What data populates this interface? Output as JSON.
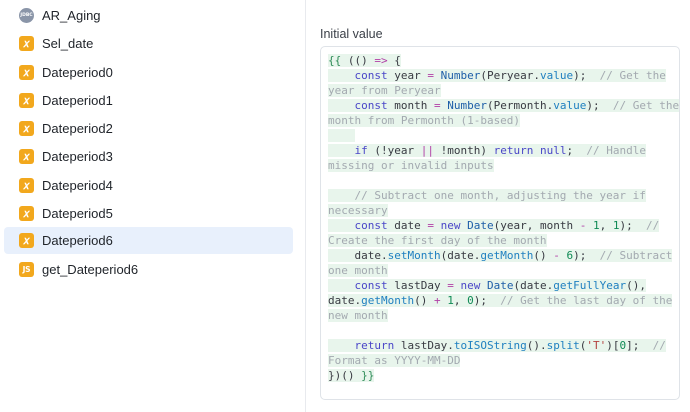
{
  "sidebar": {
    "items": [
      {
        "label": "AR_Aging",
        "icon": "database-icon",
        "icon_text": "JDBC",
        "selected": false
      },
      {
        "label": "Sel_date",
        "icon": "variable-icon",
        "icon_text": "𝑥",
        "selected": false
      },
      {
        "label": "Dateperiod0",
        "icon": "variable-icon",
        "icon_text": "𝑥",
        "selected": false
      },
      {
        "label": "Dateperiod1",
        "icon": "variable-icon",
        "icon_text": "𝑥",
        "selected": false
      },
      {
        "label": "Dateperiod2",
        "icon": "variable-icon",
        "icon_text": "𝑥",
        "selected": false
      },
      {
        "label": "Dateperiod3",
        "icon": "variable-icon",
        "icon_text": "𝑥",
        "selected": false
      },
      {
        "label": "Dateperiod4",
        "icon": "variable-icon",
        "icon_text": "𝑥",
        "selected": false
      },
      {
        "label": "Dateperiod5",
        "icon": "variable-icon",
        "icon_text": "𝑥",
        "selected": false
      },
      {
        "label": "Dateperiod6",
        "icon": "variable-icon",
        "icon_text": "𝑥",
        "selected": true
      },
      {
        "label": "get_Dateperiod6",
        "icon": "js-query-icon",
        "icon_text": "JS",
        "selected": false
      }
    ]
  },
  "panel": {
    "title": "Initial value",
    "code_lines": [
      [
        [
          "brace",
          "{{ "
        ],
        [
          "",
          "(() "
        ],
        [
          "op",
          "=>"
        ],
        [
          "",
          " {"
        ]
      ],
      [
        [
          "",
          "    "
        ],
        [
          "kw",
          "const"
        ],
        [
          "",
          " year "
        ],
        [
          "op",
          "="
        ],
        [
          "",
          " "
        ],
        [
          "fn",
          "Number"
        ],
        [
          "",
          "(Peryear."
        ],
        [
          "prop",
          "value"
        ],
        [
          "",
          ");  "
        ],
        [
          "cm",
          "// Get the"
        ]
      ],
      [
        [
          "cm",
          "year from Peryear"
        ]
      ],
      [
        [
          "",
          "    "
        ],
        [
          "kw",
          "const"
        ],
        [
          "",
          " month "
        ],
        [
          "op",
          "="
        ],
        [
          "",
          " "
        ],
        [
          "fn",
          "Number"
        ],
        [
          "",
          "(Permonth."
        ],
        [
          "prop",
          "value"
        ],
        [
          "",
          ");  "
        ],
        [
          "cm",
          "// Get the"
        ]
      ],
      [
        [
          "cm",
          "month from Permonth (1-based)"
        ]
      ],
      [
        [
          "",
          "    "
        ]
      ],
      [
        [
          "",
          "    "
        ],
        [
          "kw",
          "if"
        ],
        [
          "",
          " (!year "
        ],
        [
          "op",
          "||"
        ],
        [
          "",
          " !month) "
        ],
        [
          "kw",
          "return"
        ],
        [
          "",
          " "
        ],
        [
          "kw",
          "null"
        ],
        [
          "",
          ";  "
        ],
        [
          "cm",
          "// Handle"
        ]
      ],
      [
        [
          "cm",
          "missing or invalid inputs"
        ]
      ],
      [
        [
          "",
          ""
        ]
      ],
      [
        [
          "",
          "    "
        ],
        [
          "cm",
          "// Subtract one month, adjusting the year if"
        ]
      ],
      [
        [
          "cm",
          "necessary"
        ]
      ],
      [
        [
          "",
          "    "
        ],
        [
          "kw",
          "const"
        ],
        [
          "",
          " date "
        ],
        [
          "op",
          "="
        ],
        [
          "",
          " "
        ],
        [
          "kw",
          "new"
        ],
        [
          "",
          " "
        ],
        [
          "fn",
          "Date"
        ],
        [
          "",
          "(year, month "
        ],
        [
          "op",
          "-"
        ],
        [
          "",
          " "
        ],
        [
          "num",
          "1"
        ],
        [
          "",
          ", "
        ],
        [
          "num",
          "1"
        ],
        [
          "",
          ");  "
        ],
        [
          "cm",
          "//"
        ]
      ],
      [
        [
          "cm",
          "Create the first day of the month"
        ]
      ],
      [
        [
          "",
          "    date."
        ],
        [
          "prop",
          "setMonth"
        ],
        [
          "",
          "(date."
        ],
        [
          "prop",
          "getMonth"
        ],
        [
          "",
          "() "
        ],
        [
          "op",
          "-"
        ],
        [
          "",
          " "
        ],
        [
          "num",
          "6"
        ],
        [
          "",
          ");  "
        ],
        [
          "cm",
          "// Subtract"
        ]
      ],
      [
        [
          "cm",
          "one month"
        ]
      ],
      [
        [
          "",
          "    "
        ],
        [
          "kw",
          "const"
        ],
        [
          "",
          " lastDay "
        ],
        [
          "op",
          "="
        ],
        [
          "",
          " "
        ],
        [
          "kw",
          "new"
        ],
        [
          "",
          " "
        ],
        [
          "fn",
          "Date"
        ],
        [
          "",
          "(date."
        ],
        [
          "prop",
          "getFullYear"
        ],
        [
          "",
          "(),"
        ]
      ],
      [
        [
          "",
          "date."
        ],
        [
          "prop",
          "getMonth"
        ],
        [
          "",
          "() "
        ],
        [
          "op",
          "+"
        ],
        [
          "",
          " "
        ],
        [
          "num",
          "1"
        ],
        [
          "",
          ", "
        ],
        [
          "num",
          "0"
        ],
        [
          "",
          ");  "
        ],
        [
          "cm",
          "// Get the last day of the"
        ]
      ],
      [
        [
          "cm",
          "new month"
        ]
      ],
      [
        [
          "",
          ""
        ]
      ],
      [
        [
          "",
          "    "
        ],
        [
          "kw",
          "return"
        ],
        [
          "",
          " lastDay."
        ],
        [
          "prop",
          "toISOString"
        ],
        [
          "",
          "()."
        ],
        [
          "prop",
          "split"
        ],
        [
          "",
          "("
        ],
        [
          "str",
          "'T'"
        ],
        [
          "",
          ")["
        ],
        [
          "num",
          "0"
        ],
        [
          "",
          "];  "
        ],
        [
          "cm",
          "//"
        ]
      ],
      [
        [
          "cm",
          "Format as YYYY-MM-DD"
        ]
      ],
      [
        [
          "",
          "})() "
        ],
        [
          "brace",
          "}}"
        ]
      ]
    ],
    "highlighted_lines": [
      0,
      1,
      2,
      3,
      4,
      5,
      6,
      7,
      9,
      10,
      11,
      12,
      13,
      14,
      15,
      16,
      17,
      19,
      20,
      21
    ]
  }
}
